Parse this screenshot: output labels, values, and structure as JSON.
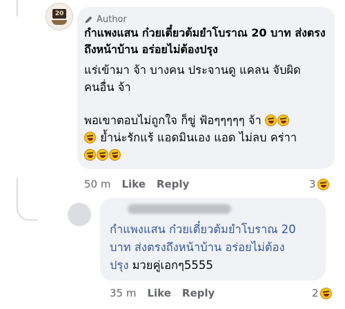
{
  "comment": {
    "author_badge": "Author",
    "author_name": "กำแพงแสน ก๋วยเตี๋ยวต้มยำโบราณ 20 บาท ส่งตรงถึงหน้าบ้าน อร่อยไม่ต้องปรุง",
    "lines": [
      "แร่เข้ามา  จ้า บางคน ประจานดู แคลน จับผิด",
      "คนอื่น จ้า",
      "",
      "พอเขาตอบไม่ถูกใจ ก็ขู่ ฟ้อๆๆๆๆๆ จ้า",
      "ย้ำน่ะรักแร้ แอดมินเอง แอด ไม่ลบ คร่าา",
      ""
    ],
    "time": "50 m",
    "like_label": "Like",
    "reply_label": "Reply",
    "reaction_count": "3"
  },
  "reply": {
    "tag_line1": "กำแพงแสน ก๋วยเตี๋ยวต้มยำโบราณ 20",
    "tag_line2": "บาท ส่งตรงถึงหน้าบ้าน อร่อยไม่ต้อง",
    "tag_line3": "ปรุง",
    "text": "มวยคู่เอกๆ5555",
    "time": "35 m",
    "like_label": "Like",
    "reply_label": "Reply",
    "reaction_count": "2"
  },
  "colors": {
    "link": "#385898",
    "bubble": "#f0f2f5",
    "meta": "#65676b"
  },
  "icons": [
    "pencil-icon",
    "laughing-emoji"
  ]
}
